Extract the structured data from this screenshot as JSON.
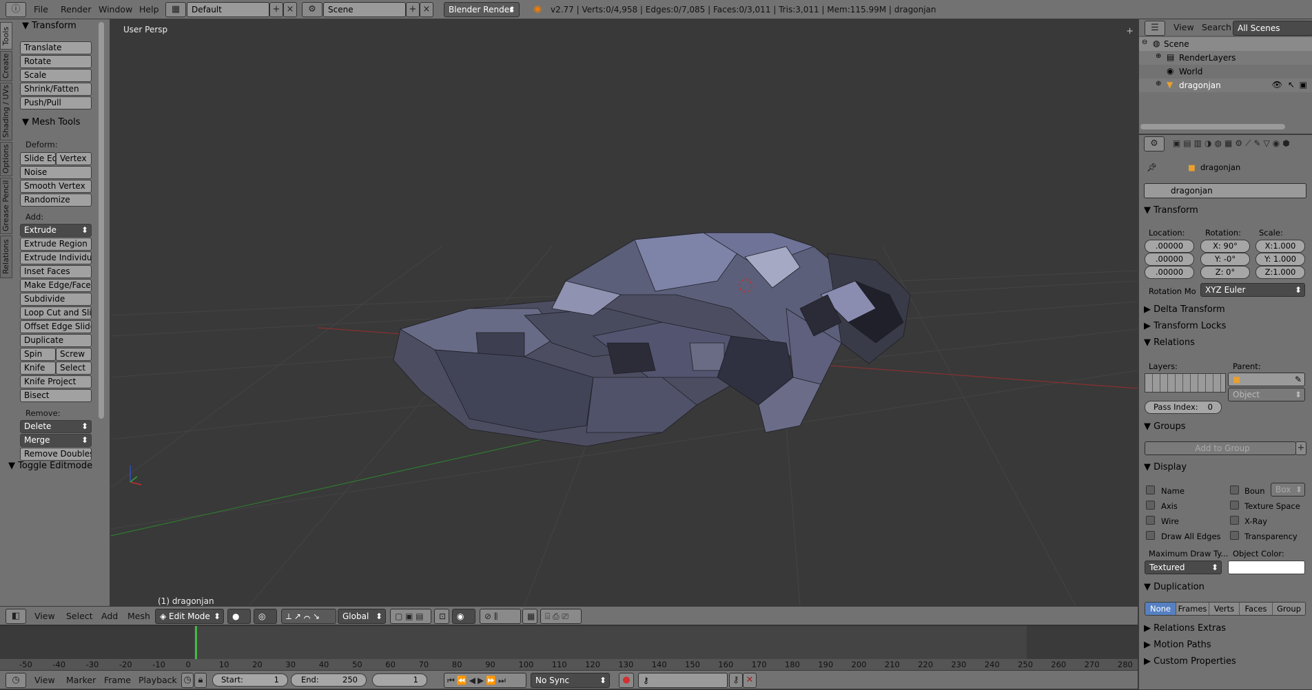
{
  "topbar": {
    "menus": [
      "File",
      "Render",
      "Window",
      "Help"
    ],
    "layout": "Default",
    "scene": "Scene",
    "engine": "Blender Render",
    "stats": "v2.77 | Verts:0/4,958 | Edges:0/7,085 | Faces:0/3,011 | Tris:3,011 | Mem:115.99M | dragonjan"
  },
  "tool_tabs": [
    "Tools",
    "Create",
    "Shading / UVs",
    "Options",
    "Grease Pencil",
    "Relations"
  ],
  "tools": {
    "transform_title": "Transform",
    "transform_buttons": [
      "Translate",
      "Rotate",
      "Scale",
      "Shrink/Fatten",
      "Push/Pull"
    ],
    "mesh_title": "Mesh Tools",
    "deform_label": "Deform:",
    "slide_edge": "Slide Ed",
    "vertex": "Vertex",
    "deform_buttons": [
      "Noise",
      "Smooth Vertex",
      "Randomize"
    ],
    "add_label": "Add:",
    "extrude": "Extrude",
    "add_buttons": [
      "Extrude Region",
      "Extrude Individual",
      "Inset Faces",
      "Make Edge/Face",
      "Subdivide",
      "Loop Cut and Slide",
      "Offset Edge Slide",
      "Duplicate"
    ],
    "spin": "Spin",
    "screw": "Screw",
    "knife": "Knife",
    "select": "Select",
    "knife_project": "Knife Project",
    "bisect": "Bisect",
    "remove_label": "Remove:",
    "delete": "Delete",
    "merge": "Merge",
    "remove_doubles": "Remove Doubles",
    "toggle_editmode": "Toggle Editmode"
  },
  "viewport": {
    "view_name": "User Persp",
    "object_label": "(1) dragonjan"
  },
  "view3d_header": {
    "menus": [
      "View",
      "Select",
      "Add",
      "Mesh"
    ],
    "mode": "Edit Mode",
    "orientation": "Global"
  },
  "timeline": {
    "ticks": [
      "-50",
      "-40",
      "-30",
      "-20",
      "-10",
      "0",
      "10",
      "20",
      "30",
      "40",
      "50",
      "60",
      "70",
      "80",
      "90",
      "100",
      "110",
      "120",
      "130",
      "140",
      "150",
      "160",
      "170",
      "180",
      "190",
      "200",
      "210",
      "220",
      "230",
      "240",
      "250",
      "260",
      "270",
      "280"
    ],
    "menus": [
      "View",
      "Marker",
      "Frame",
      "Playback"
    ],
    "start_label": "Start:",
    "start": "1",
    "end_label": "End:",
    "end": "250",
    "current": "1",
    "sync": "No Sync"
  },
  "outliner": {
    "menus": [
      "View",
      "Search"
    ],
    "filter": "All Scenes",
    "items": [
      "Scene",
      "RenderLayers",
      "World",
      "dragonjan"
    ]
  },
  "properties": {
    "breadcrumb": "dragonjan",
    "object_name": "dragonjan",
    "transform_title": "Transform",
    "location_label": "Location:",
    "rotation_label": "Rotation:",
    "scale_label": "Scale:",
    "location": [
      ".00000",
      ".00000",
      ".00000"
    ],
    "rotation": [
      "X:     90°",
      "Y:     -0°",
      "Z:       0°"
    ],
    "scale": [
      "X:1.000",
      "Y: 1.000",
      "Z:1.000"
    ],
    "rotation_mode_label": "Rotation Mo",
    "rotation_mode": "XYZ Euler",
    "delta_transform": "Delta Transform",
    "transform_locks": "Transform Locks",
    "relations": "Relations",
    "layers_label": "Layers:",
    "parent_label": "Parent:",
    "parent_type": "Object",
    "pass_index_label": "Pass Index:",
    "pass_index": "0",
    "groups": "Groups",
    "add_to_group": "Add to Group",
    "display": "Display",
    "display_left": [
      "Name",
      "Axis",
      "Wire",
      "Draw All Edges"
    ],
    "display_right": [
      "Boun",
      "Texture Space",
      "X-Ray",
      "Transparency"
    ],
    "bounds_type": "Box",
    "max_draw_label": "Maximum Draw Ty...",
    "object_color_label": "Object Color:",
    "max_draw": "Textured",
    "object_color": "#ffffff",
    "duplication": "Duplication",
    "dup_options": [
      "None",
      "Frames",
      "Verts",
      "Faces",
      "Group"
    ],
    "relations_extras": "Relations Extras",
    "motion_paths": "Motion Paths",
    "custom_properties": "Custom Properties"
  }
}
